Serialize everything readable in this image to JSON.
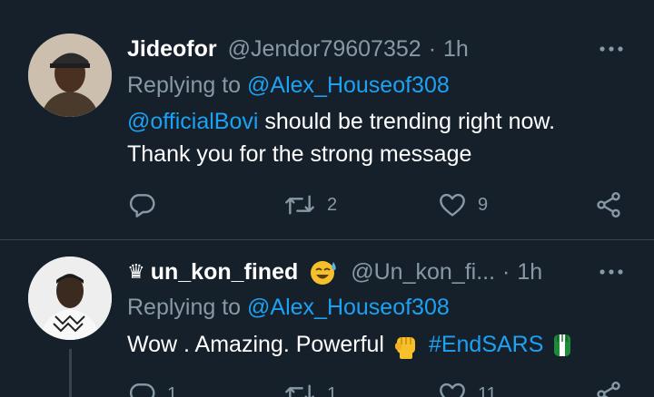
{
  "tweets": [
    {
      "name": "Jideofor",
      "handle": "@Jendor79607352",
      "separator": "·",
      "time": "1h",
      "replying_prefix": "Replying to ",
      "replying_to": "@Alex_Houseof308",
      "body_mention": "@officialBovi",
      "body_line1_rest": " should be trending right now.",
      "body_line2": "Thank you for the strong message",
      "reply_count": "",
      "retweet_count": "2",
      "like_count": "9"
    },
    {
      "name": "un_kon_fined",
      "handle": "@Un_kon_fi...",
      "separator": "·",
      "time": "1h",
      "replying_prefix": "Replying to ",
      "replying_to": "@Alex_Houseof308",
      "body_text": "Wow . Amazing. Powerful ",
      "hashtag": "#EndSARS",
      "reply_count": "1",
      "retweet_count": "1",
      "like_count": "11"
    }
  ],
  "icons": {
    "more": "more-horizontal-icon",
    "reply": "reply-icon",
    "retweet": "retweet-icon",
    "like": "heart-icon",
    "share": "share-icon",
    "crown": "crown-icon",
    "sweat_smile": "sweat-smile-emoji",
    "fist": "raised-fist-emoji",
    "flag_fist": "nigeria-fist-emoji"
  },
  "colors": {
    "background": "#15202b",
    "divider": "#38444d",
    "text_primary": "#ffffff",
    "text_secondary": "#8899a6",
    "accent": "#1da1f2"
  }
}
